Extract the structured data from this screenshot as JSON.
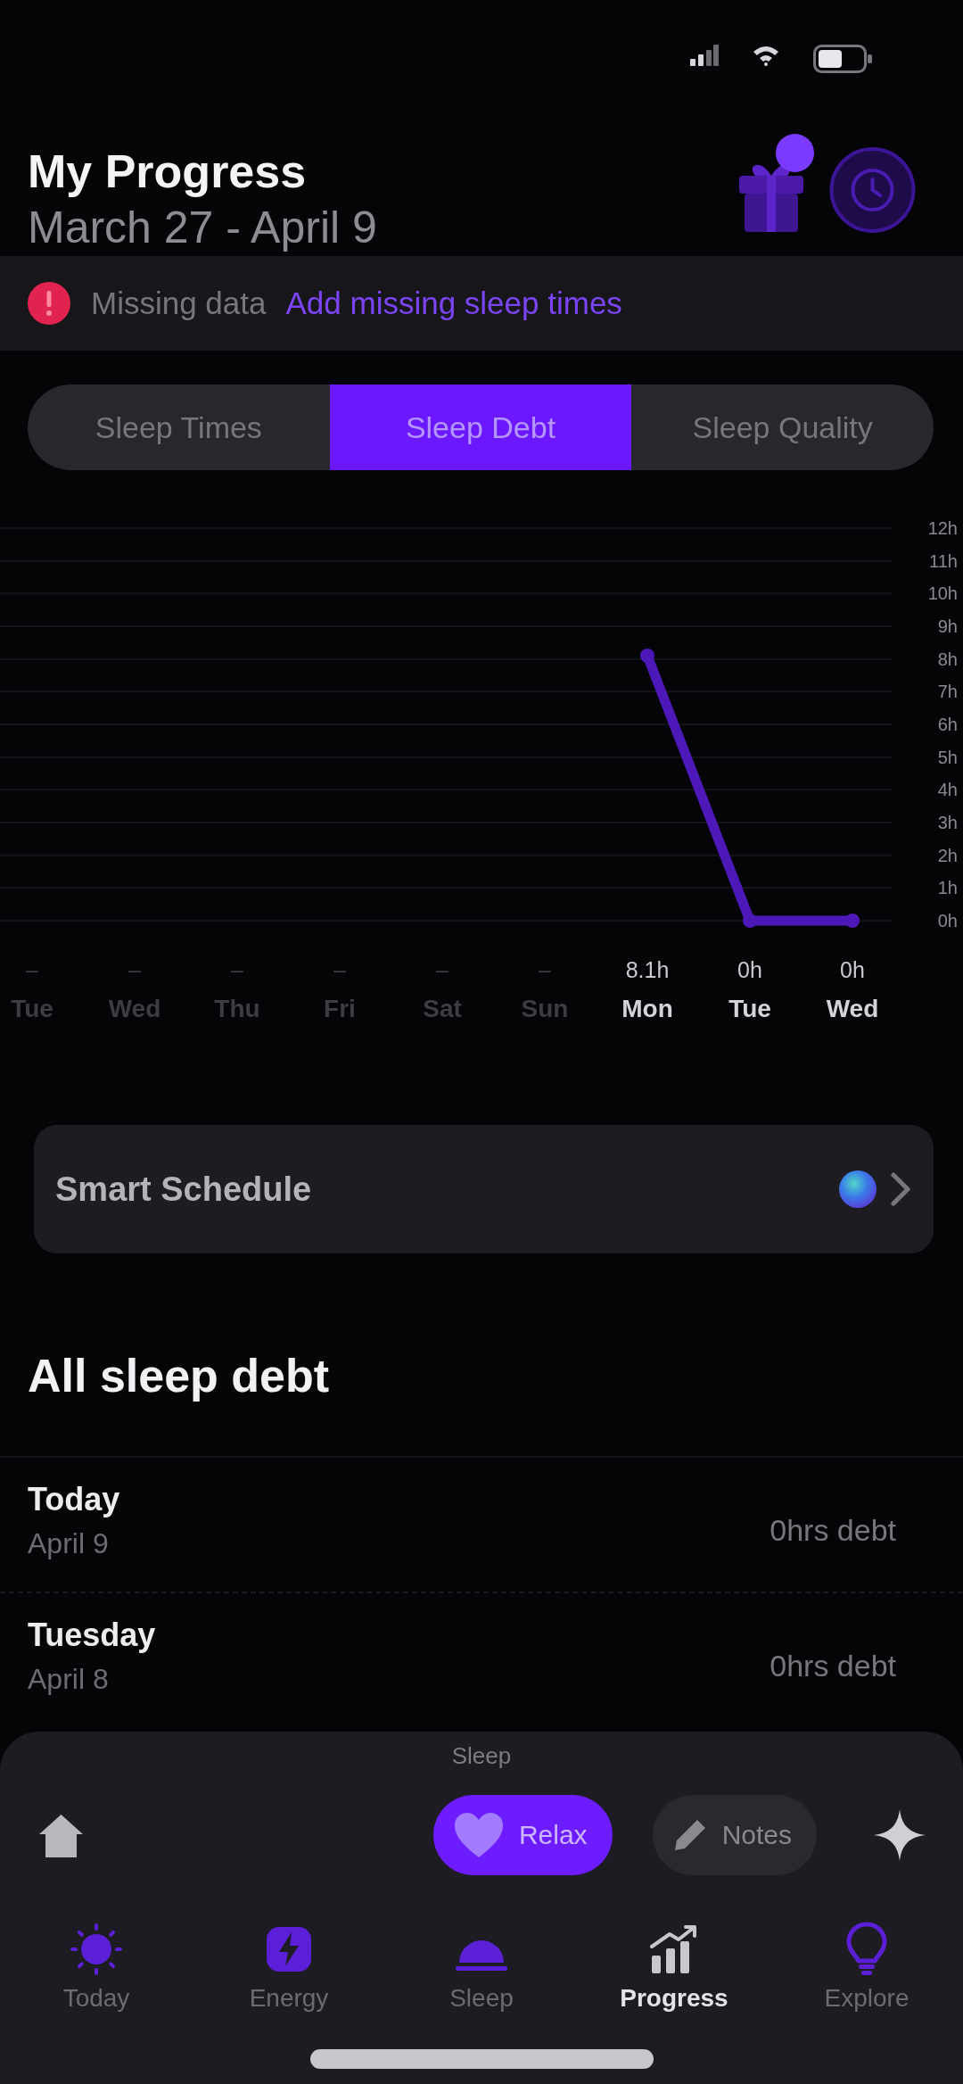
{
  "header": {
    "title": "My Progress",
    "subtitle": "March 27 - April 9",
    "badge": true
  },
  "alert": {
    "message": "Missing data",
    "link": "Add missing sleep times"
  },
  "tabs": [
    {
      "label": "Sleep Times",
      "selected": false
    },
    {
      "label": "Sleep Debt",
      "selected": true
    },
    {
      "label": "Sleep Quality",
      "selected": false
    }
  ],
  "chart": {
    "chart_data": {
      "type": "line",
      "categories": [
        "Tue",
        "Wed",
        "Thu",
        "Fri",
        "Sat",
        "Sun",
        "Mon",
        "Tue",
        "Wed"
      ],
      "series": [
        {
          "color": "#4c18b8",
          "marker": true,
          "values": [
            null,
            null,
            null,
            null,
            null,
            null,
            8.1,
            0,
            0
          ]
        }
      ],
      "ylim": [
        0,
        12
      ],
      "yticks": [
        {
          "value": 0,
          "label": "0h"
        },
        {
          "value": 1,
          "label": "1h"
        },
        {
          "value": 2,
          "label": "2h"
        },
        {
          "value": 3,
          "label": "3h"
        },
        {
          "value": 4,
          "label": "4h"
        },
        {
          "value": 5,
          "label": "5h"
        },
        {
          "value": 6,
          "label": "6h"
        },
        {
          "value": 7,
          "label": "7h"
        },
        {
          "value": 8,
          "label": "8h"
        },
        {
          "value": 9,
          "label": "9h"
        },
        {
          "value": 10,
          "label": "10h"
        },
        {
          "value": 11,
          "label": "11h"
        },
        {
          "value": 12,
          "label": "12h"
        }
      ],
      "grid": true,
      "value_labels": [
        "–",
        "–",
        "–",
        "–",
        "–",
        "–",
        "8.1h",
        "0h",
        "0h"
      ]
    }
  },
  "smart_schedule": {
    "label": "Smart Schedule"
  },
  "sleep_debt": {
    "title": "All sleep debt",
    "rows": [
      {
        "day": "Today",
        "date": "April 9",
        "debt": "0hrs debt"
      },
      {
        "day": "Tuesday",
        "date": "April 8",
        "debt": "0hrs debt"
      }
    ]
  },
  "action_sheet": {
    "title": "Sleep",
    "buttons": [
      {
        "kind": "primary",
        "label": "Relax"
      },
      {
        "kind": "secondary",
        "label": "Notes"
      }
    ]
  },
  "nav": [
    {
      "label": "Today",
      "selected": false
    },
    {
      "label": "Energy",
      "selected": false
    },
    {
      "label": "Sleep",
      "selected": false
    },
    {
      "label": "Progress",
      "selected": true
    },
    {
      "label": "Explore",
      "selected": false
    }
  ]
}
